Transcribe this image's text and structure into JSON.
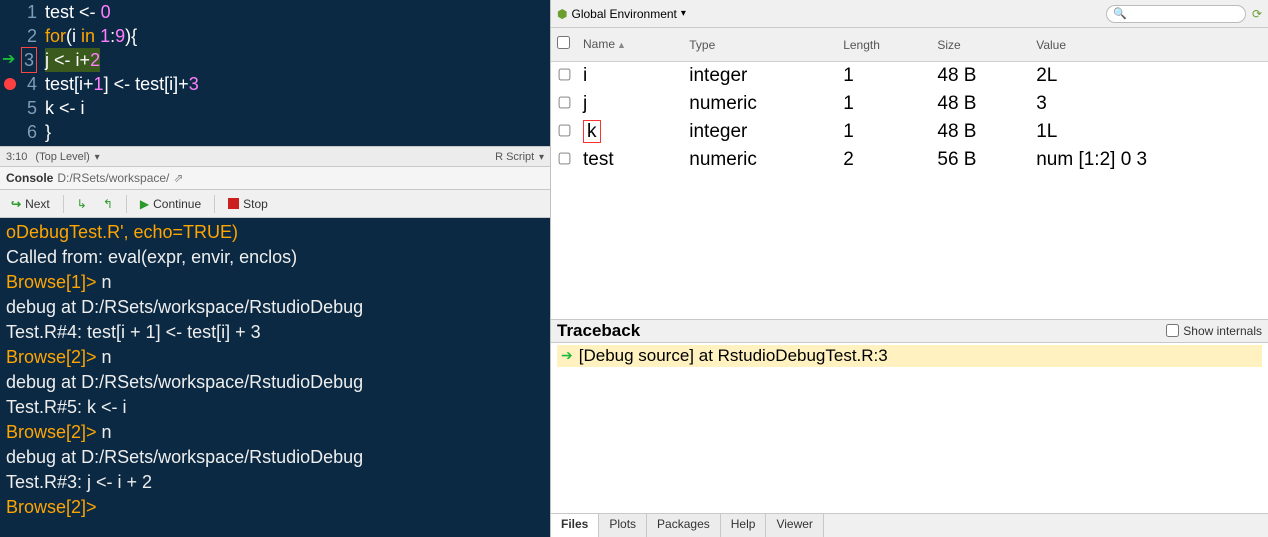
{
  "editor": {
    "lines": [
      {
        "n": "1",
        "html": "<span class='id'>test</span> <span class='op'>&lt;-</span> <span class='num'>0</span>"
      },
      {
        "n": "2",
        "html": "<span class='kw'>for</span><span class='paren'>(</span><span class='id'>i</span> <span class='kw'>in</span> <span class='num'>1</span><span class='op'>:</span><span class='num'>9</span><span class='paren'>)</span><span class='paren'>{</span>"
      },
      {
        "n": "3",
        "arrow": true,
        "boxed": true,
        "highlight": true,
        "html": "  <span class='id'>j</span> <span class='op'>&lt;-</span> <span class='id'>i</span><span class='op'>+</span><span class='num'>2</span>"
      },
      {
        "n": "4",
        "breakpoint": true,
        "html": "  <span class='id'>test</span><span class='paren'>[</span><span class='id'>i</span><span class='op'>+</span><span class='num'>1</span><span class='paren'>]</span> <span class='op'>&lt;-</span> <span class='id'>test</span><span class='paren'>[</span><span class='id'>i</span><span class='paren'>]</span><span class='op'>+</span><span class='num'>3</span>"
      },
      {
        "n": "5",
        "html": "  <span class='id'>k</span> <span class='op'>&lt;-</span> <span class='id'>i</span>"
      },
      {
        "n": "6",
        "html": "  <span class='paren'>}</span>"
      }
    ],
    "status": {
      "pos": "3:10",
      "scope": "(Top Level)",
      "lang": "R Script"
    }
  },
  "console_header": {
    "title": "Console",
    "path": "D:/RSets/workspace/"
  },
  "debug_toolbar": {
    "next": "Next",
    "continue": "Continue",
    "stop": "Stop"
  },
  "console_lines": [
    "oDebugTest.R', echo=TRUE)",
    "Called from: eval(expr, envir, enclos)",
    {
      "prompt": "Browse[1]>",
      "cmd": " n"
    },
    "debug at D:/RSets/workspace/RstudioDebug",
    "Test.R#4: test[i + 1] <- test[i] + 3",
    {
      "prompt": "Browse[2]>",
      "cmd": " n"
    },
    "debug at D:/RSets/workspace/RstudioDebug",
    "Test.R#5: k <- i",
    {
      "prompt": "Browse[2]>",
      "cmd": " n"
    },
    "debug at D:/RSets/workspace/RstudioDebug",
    "Test.R#3: j <- i + 2",
    {
      "prompt": "Browse[2]>",
      "cmd": " "
    }
  ],
  "env": {
    "scope": "Global Environment",
    "search_placeholder": "",
    "columns": {
      "name": "Name",
      "type": "Type",
      "length": "Length",
      "size": "Size",
      "value": "Value"
    },
    "rows": [
      {
        "name": "i",
        "type": "integer",
        "length": "1",
        "size": "48 B",
        "value": "2L"
      },
      {
        "name": "j",
        "type": "numeric",
        "length": "1",
        "size": "48 B",
        "value": "3"
      },
      {
        "name": "k",
        "type": "integer",
        "length": "1",
        "size": "48 B",
        "value": "1L",
        "boxed": true
      },
      {
        "name": "test",
        "type": "numeric",
        "length": "2",
        "size": "56 B",
        "value": "num [1:2] 0 3"
      }
    ]
  },
  "traceback": {
    "title": "Traceback",
    "show_internals": "Show internals",
    "frame": "[Debug source] at RstudioDebugTest.R:3"
  },
  "bottom_tabs": [
    "Files",
    "Plots",
    "Packages",
    "Help",
    "Viewer"
  ]
}
